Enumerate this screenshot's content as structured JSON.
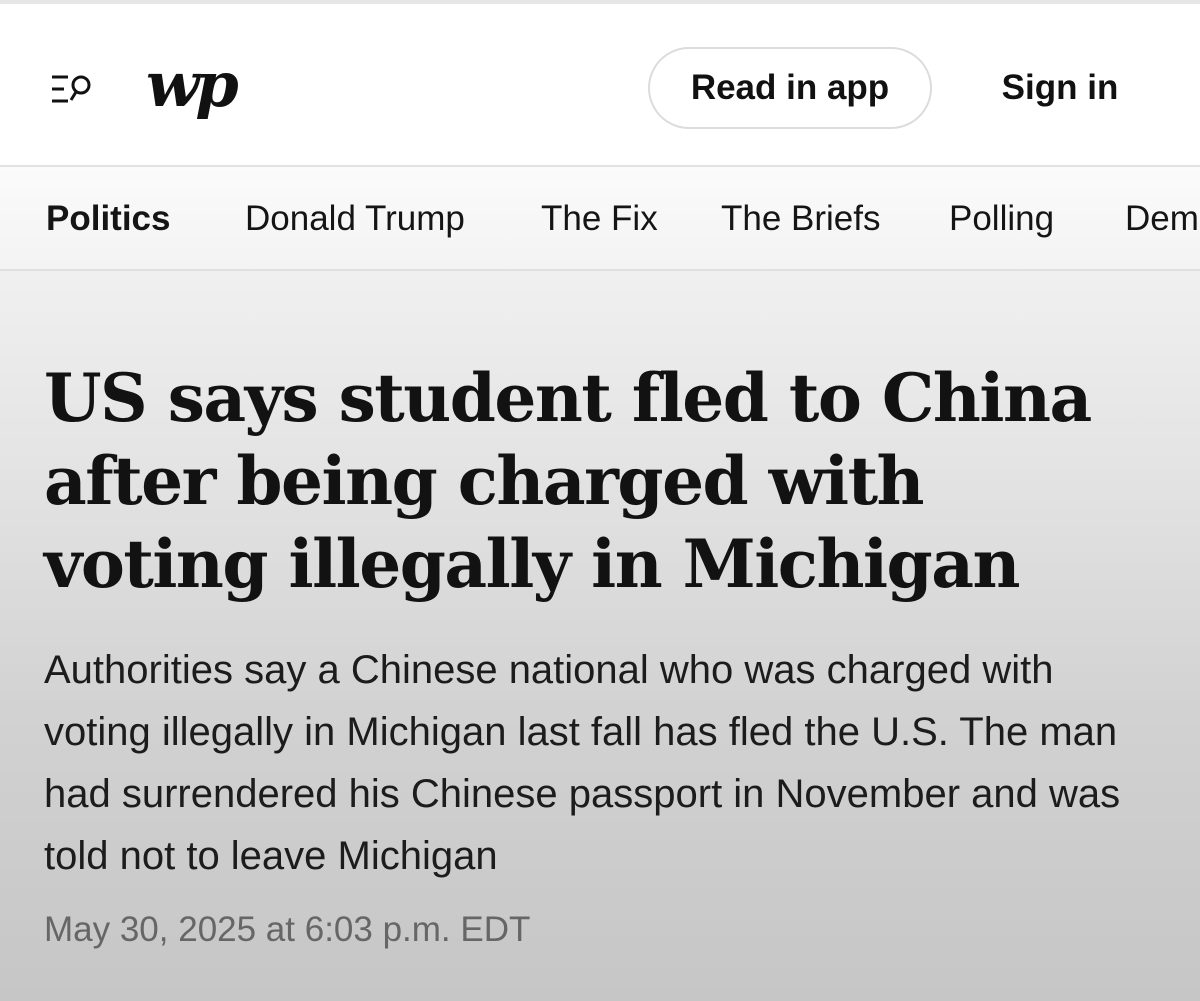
{
  "header": {
    "menu_icon": "menu-search-icon",
    "logo_text": "wp",
    "read_in_app_label": "Read in app",
    "sign_in_label": "Sign in"
  },
  "nav": {
    "items": [
      {
        "label": "Politics",
        "active": true
      },
      {
        "label": "Donald Trump",
        "active": false
      },
      {
        "label": "The Fix",
        "active": false
      },
      {
        "label": "The Briefs",
        "active": false
      },
      {
        "label": "Polling",
        "active": false
      },
      {
        "label": "Dem",
        "active": false
      }
    ]
  },
  "article": {
    "headline": "US says student fled to China after being charged with voting illegally in Michigan",
    "dek": "Authorities say a Chinese national who was charged with voting illegally in Michigan last fall has fled the U.S. The man had surrendered his Chinese passport in November and was told not to leave Michigan",
    "timestamp": "May 30, 2025 at 6:03 p.m. EDT"
  },
  "colors": {
    "text": "#111111",
    "muted": "#666666",
    "border": "#dcdcdc"
  }
}
